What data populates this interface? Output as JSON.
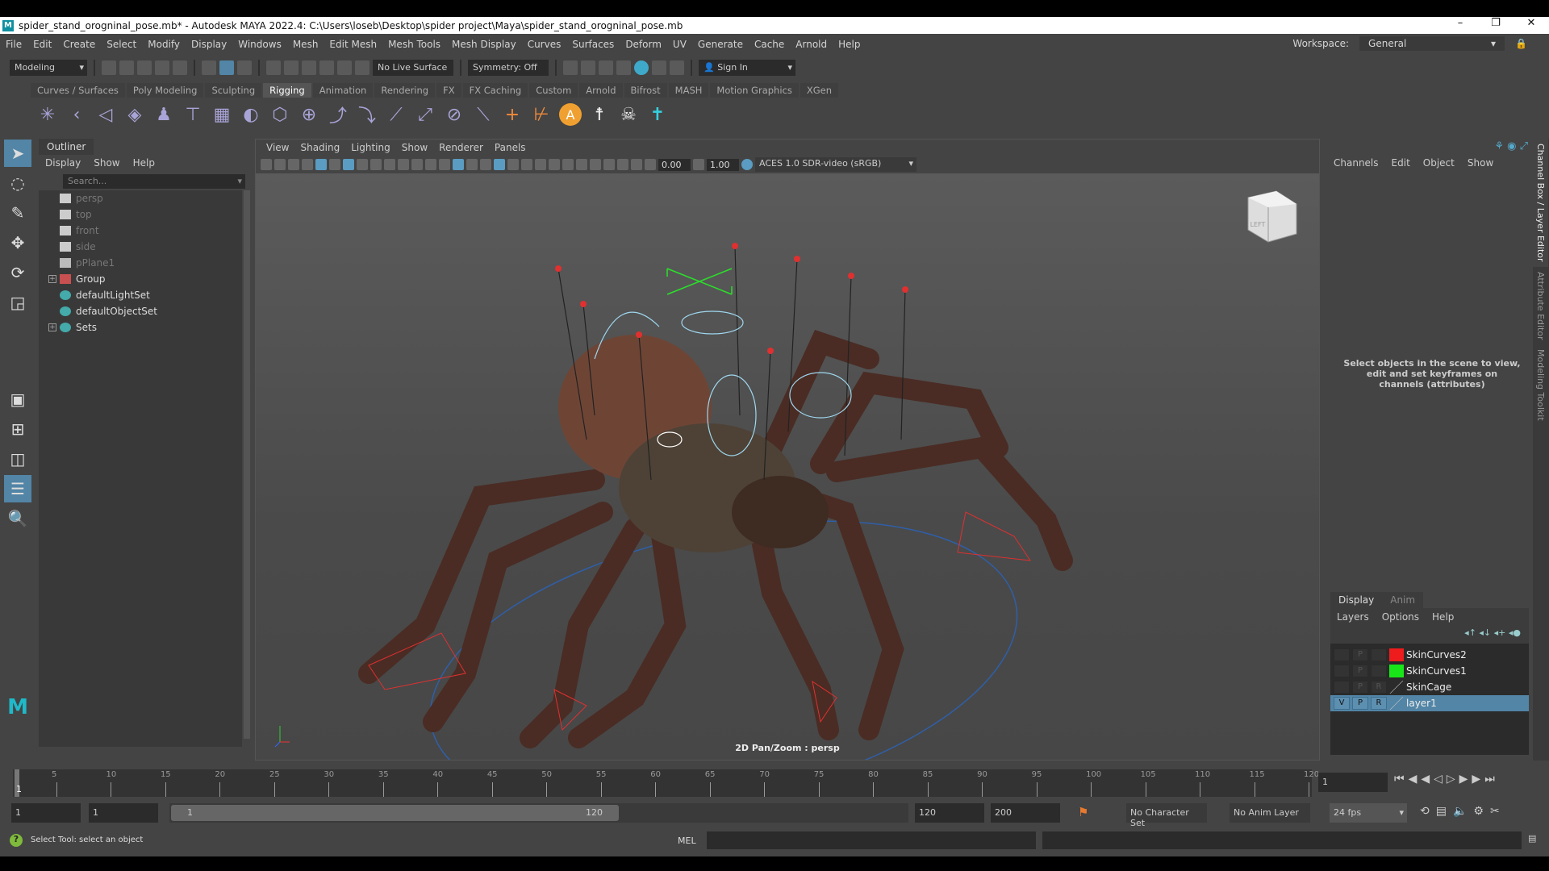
{
  "window": {
    "title": "spider_stand_orogninal_pose.mb* - Autodesk MAYA 2022.4: C:\\Users\\loseb\\Desktop\\spider project\\Maya\\spider_stand_orogninal_pose.mb",
    "minimize": "–",
    "restore": "❐",
    "close": "✕"
  },
  "menus": [
    "File",
    "Edit",
    "Create",
    "Select",
    "Modify",
    "Display",
    "Windows",
    "Mesh",
    "Edit Mesh",
    "Mesh Tools",
    "Mesh Display",
    "Curves",
    "Surfaces",
    "Deform",
    "UV",
    "Generate",
    "Cache",
    "Arnold",
    "Help"
  ],
  "workspace": {
    "label": "Workspace:",
    "value": "General"
  },
  "toolbar": {
    "mode": "Modeling",
    "live_surface": "No Live Surface",
    "symmetry": "Symmetry: Off",
    "sign_in": "Sign In"
  },
  "shelf_tabs": [
    "Curves / Surfaces",
    "Poly Modeling",
    "Sculpting",
    "Rigging",
    "Animation",
    "Rendering",
    "FX",
    "FX Caching",
    "Custom",
    "Arnold",
    "Bifrost",
    "MASH",
    "Motion Graphics",
    "XGen"
  ],
  "active_shelf": "Rigging",
  "outliner": {
    "tab": "Outliner",
    "menus": [
      "Display",
      "Show",
      "Help"
    ],
    "search_placeholder": "Search...",
    "items": [
      {
        "label": "persp",
        "dim": true,
        "icon": "camera"
      },
      {
        "label": "top",
        "dim": true,
        "icon": "camera"
      },
      {
        "label": "front",
        "dim": true,
        "icon": "camera"
      },
      {
        "label": "side",
        "dim": true,
        "icon": "camera"
      },
      {
        "label": "pPlane1",
        "dim": true,
        "icon": "mesh"
      },
      {
        "label": "Group",
        "expand": true,
        "icon": "group"
      },
      {
        "label": "defaultLightSet",
        "icon": "set"
      },
      {
        "label": "defaultObjectSet",
        "icon": "set"
      },
      {
        "label": "Sets",
        "expand": true,
        "icon": "set"
      }
    ]
  },
  "viewport": {
    "menus": [
      "View",
      "Shading",
      "Lighting",
      "Show",
      "Renderer",
      "Panels"
    ],
    "exposure": "0.00",
    "gamma": "1.00",
    "color_space": "ACES 1.0 SDR-video (sRGB)",
    "hud": "2D Pan/Zoom : persp",
    "viewcube_label": "LEFT"
  },
  "channel_box": {
    "menus": [
      "Channels",
      "Edit",
      "Object",
      "Show"
    ],
    "empty_message": "Select objects in the scene to view, edit and set keyframes on channels (attributes)"
  },
  "side_tabs": [
    "Channel Box / Layer Editor",
    "Attribute Editor",
    "Modeling Toolkit"
  ],
  "layer_editor": {
    "tabs": [
      "Display",
      "Anim"
    ],
    "menus": [
      "Layers",
      "Options",
      "Help"
    ],
    "layers": [
      {
        "name": "SkinCurves2",
        "v": "",
        "p": "P",
        "r": "",
        "color": "#ee1c1c"
      },
      {
        "name": "SkinCurves1",
        "v": "",
        "p": "P",
        "r": "",
        "color": "#19e619"
      },
      {
        "name": "SkinCage",
        "v": "",
        "p": "P",
        "r": "R",
        "color": ""
      },
      {
        "name": "layer1",
        "v": "V",
        "p": "P",
        "r": "R",
        "color": "",
        "selected": true
      }
    ]
  },
  "timeline": {
    "ticks": [
      5,
      10,
      15,
      20,
      25,
      30,
      35,
      40,
      45,
      50,
      55,
      60,
      65,
      70,
      75,
      80,
      85,
      90,
      95,
      100,
      105,
      110,
      115,
      120
    ],
    "current_frame_label": "1",
    "current_frame": "1",
    "start": "1",
    "range_start": "1",
    "range_slider_start": "1",
    "range_slider_end": "120",
    "range_end": "120",
    "end": "200",
    "character_set": "No Character Set",
    "anim_layer": "No Anim Layer",
    "fps": "24 fps"
  },
  "status": {
    "help": "Select Tool: select an object",
    "cmd_lang": "MEL"
  }
}
